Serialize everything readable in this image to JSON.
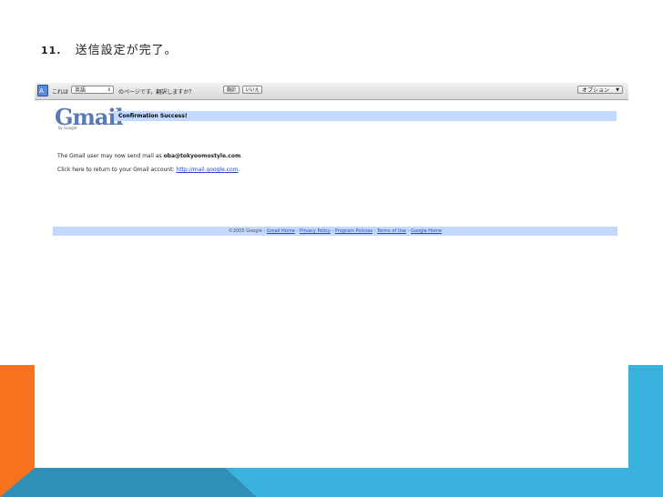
{
  "slide": {
    "number": "11.",
    "title": "送信設定が完了。"
  },
  "translate_bar": {
    "prefix": "これは",
    "language": "英語",
    "question": "のページです。翻訳しますか？",
    "yes_label": "翻訳",
    "no_label": "いいえ",
    "options_label": "オプション"
  },
  "gmail": {
    "logo": "Gmail",
    "logo_sub": "by Google",
    "banner": "Confirmation Success!",
    "message1_prefix": "The Gmail user may now send mail as ",
    "message1_email": "oba@tokyoomostyle.com",
    "message1_suffix": ".",
    "message2_prefix": "Click here to return to your Gmail account: ",
    "message2_link": "http://mail.google.com",
    "message2_suffix": ".",
    "footer": {
      "copyright": "©2005 Google - ",
      "links": [
        "Gmail Home",
        "Privacy Policy",
        "Program Policies",
        "Terms of Use",
        "Google Home"
      ],
      "sep": " - "
    }
  },
  "colors": {
    "banner_bg": "#c3d9ff",
    "link": "#2a47c4",
    "deco_orange": "#f7731e",
    "deco_blue": "#3bb1de",
    "deco_blue_dark": "#2f8fb6"
  }
}
